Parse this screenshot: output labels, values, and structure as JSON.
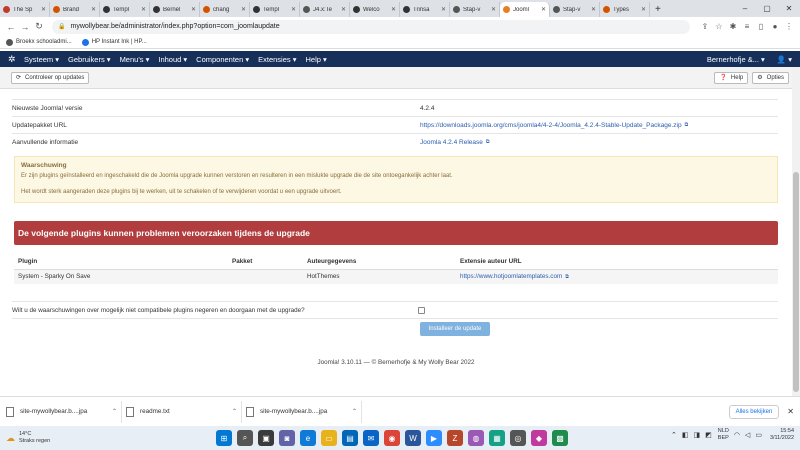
{
  "browser": {
    "tabs": [
      {
        "label": "The Sp",
        "color": "#c0392b"
      },
      {
        "label": "Brand",
        "color": "#d35400"
      },
      {
        "label": "Templ",
        "color": "#333333"
      },
      {
        "label": "Bernel",
        "color": "#333333"
      },
      {
        "label": "chang",
        "color": "#d35400"
      },
      {
        "label": "Templ",
        "color": "#333333"
      },
      {
        "label": "J4.x:Te",
        "color": "#555555"
      },
      {
        "label": "Welco",
        "color": "#333333"
      },
      {
        "label": "Trinsa",
        "color": "#333333"
      },
      {
        "label": "Stap-v",
        "color": "#555555"
      },
      {
        "label": "Jooml",
        "color": "#e67e22",
        "active": true
      },
      {
        "label": "Stap-v",
        "color": "#555555"
      },
      {
        "label": "Types",
        "color": "#d35400"
      }
    ],
    "new_tab": "+",
    "url": "mywollybear.be/administrator/index.php?option=com_joomlaupdate",
    "bookmarks": [
      "Broekx schooladmi...",
      "HP Instant Ink | HP..."
    ]
  },
  "joomla_nav": {
    "menus": [
      "Systeem ▾",
      "Gebruikers ▾",
      "Menu's ▾",
      "Inhoud ▾",
      "Componenten ▾",
      "Extensies ▾",
      "Help ▾"
    ],
    "site_name": "Bernerhofje &... ▾",
    "user": "👤 ▾"
  },
  "toolbar": {
    "check_updates": "Controleer op updates",
    "help": "Help",
    "options": "Opties"
  },
  "info": {
    "rows": [
      {
        "label": "Nieuwste Joomla! versie",
        "value": "4.2.4",
        "link": false
      },
      {
        "label": "Updatepakket URL",
        "value": "https://downloads.joomla.org/cms/joomla4/4-2-4/Joomla_4.2.4-Stable-Update_Package.zip",
        "link": true
      },
      {
        "label": "Aanvullende informatie",
        "value": "Joomla 4.2.4 Release",
        "link": true
      }
    ]
  },
  "warning": {
    "title": "Waarschuwing",
    "line1": "Er zijn plugins geïnstalleerd en ingeschakeld die de Joomla upgrade kunnen verstoren en resulteren in een mislukte upgrade die de site ontoegankelijk achter laat.",
    "line2": "Het wordt sterk aangeraden deze plugins bij te werken, uit te schakelen of te verwijderen voordat u een upgrade uitvoert."
  },
  "plugins": {
    "heading": "De volgende plugins kunnen problemen veroorzaken tijdens de upgrade",
    "columns": [
      "Plugin",
      "Pakket",
      "Auteurgegevens",
      "Extensie auteur URL"
    ],
    "rows": [
      {
        "plugin": "System - Sparky On Save",
        "package": "",
        "author": "HotThemes",
        "url": "https://www.hotjoomlatemplates.com"
      }
    ]
  },
  "question": "Wilt u de waarschuwingen over mogelijk niet compatibele plugins negeren en doorgaan met de upgrade?",
  "install_button": "Installeer de update",
  "footer": "Joomla! 3.10.11  —  © Bernerhofje & My Wolly Bear 2022",
  "downloads": {
    "items": [
      "site-mywollybear.b....jpa",
      "readme.txt",
      "site-mywollybear.b....jpa"
    ],
    "show_all": "Alles bekijken"
  },
  "taskbar": {
    "temperature": "14°C",
    "weather": "Straks regen",
    "lang1": "NLD",
    "lang2": "BEP",
    "time": "15:54",
    "date": "3/11/2022"
  }
}
